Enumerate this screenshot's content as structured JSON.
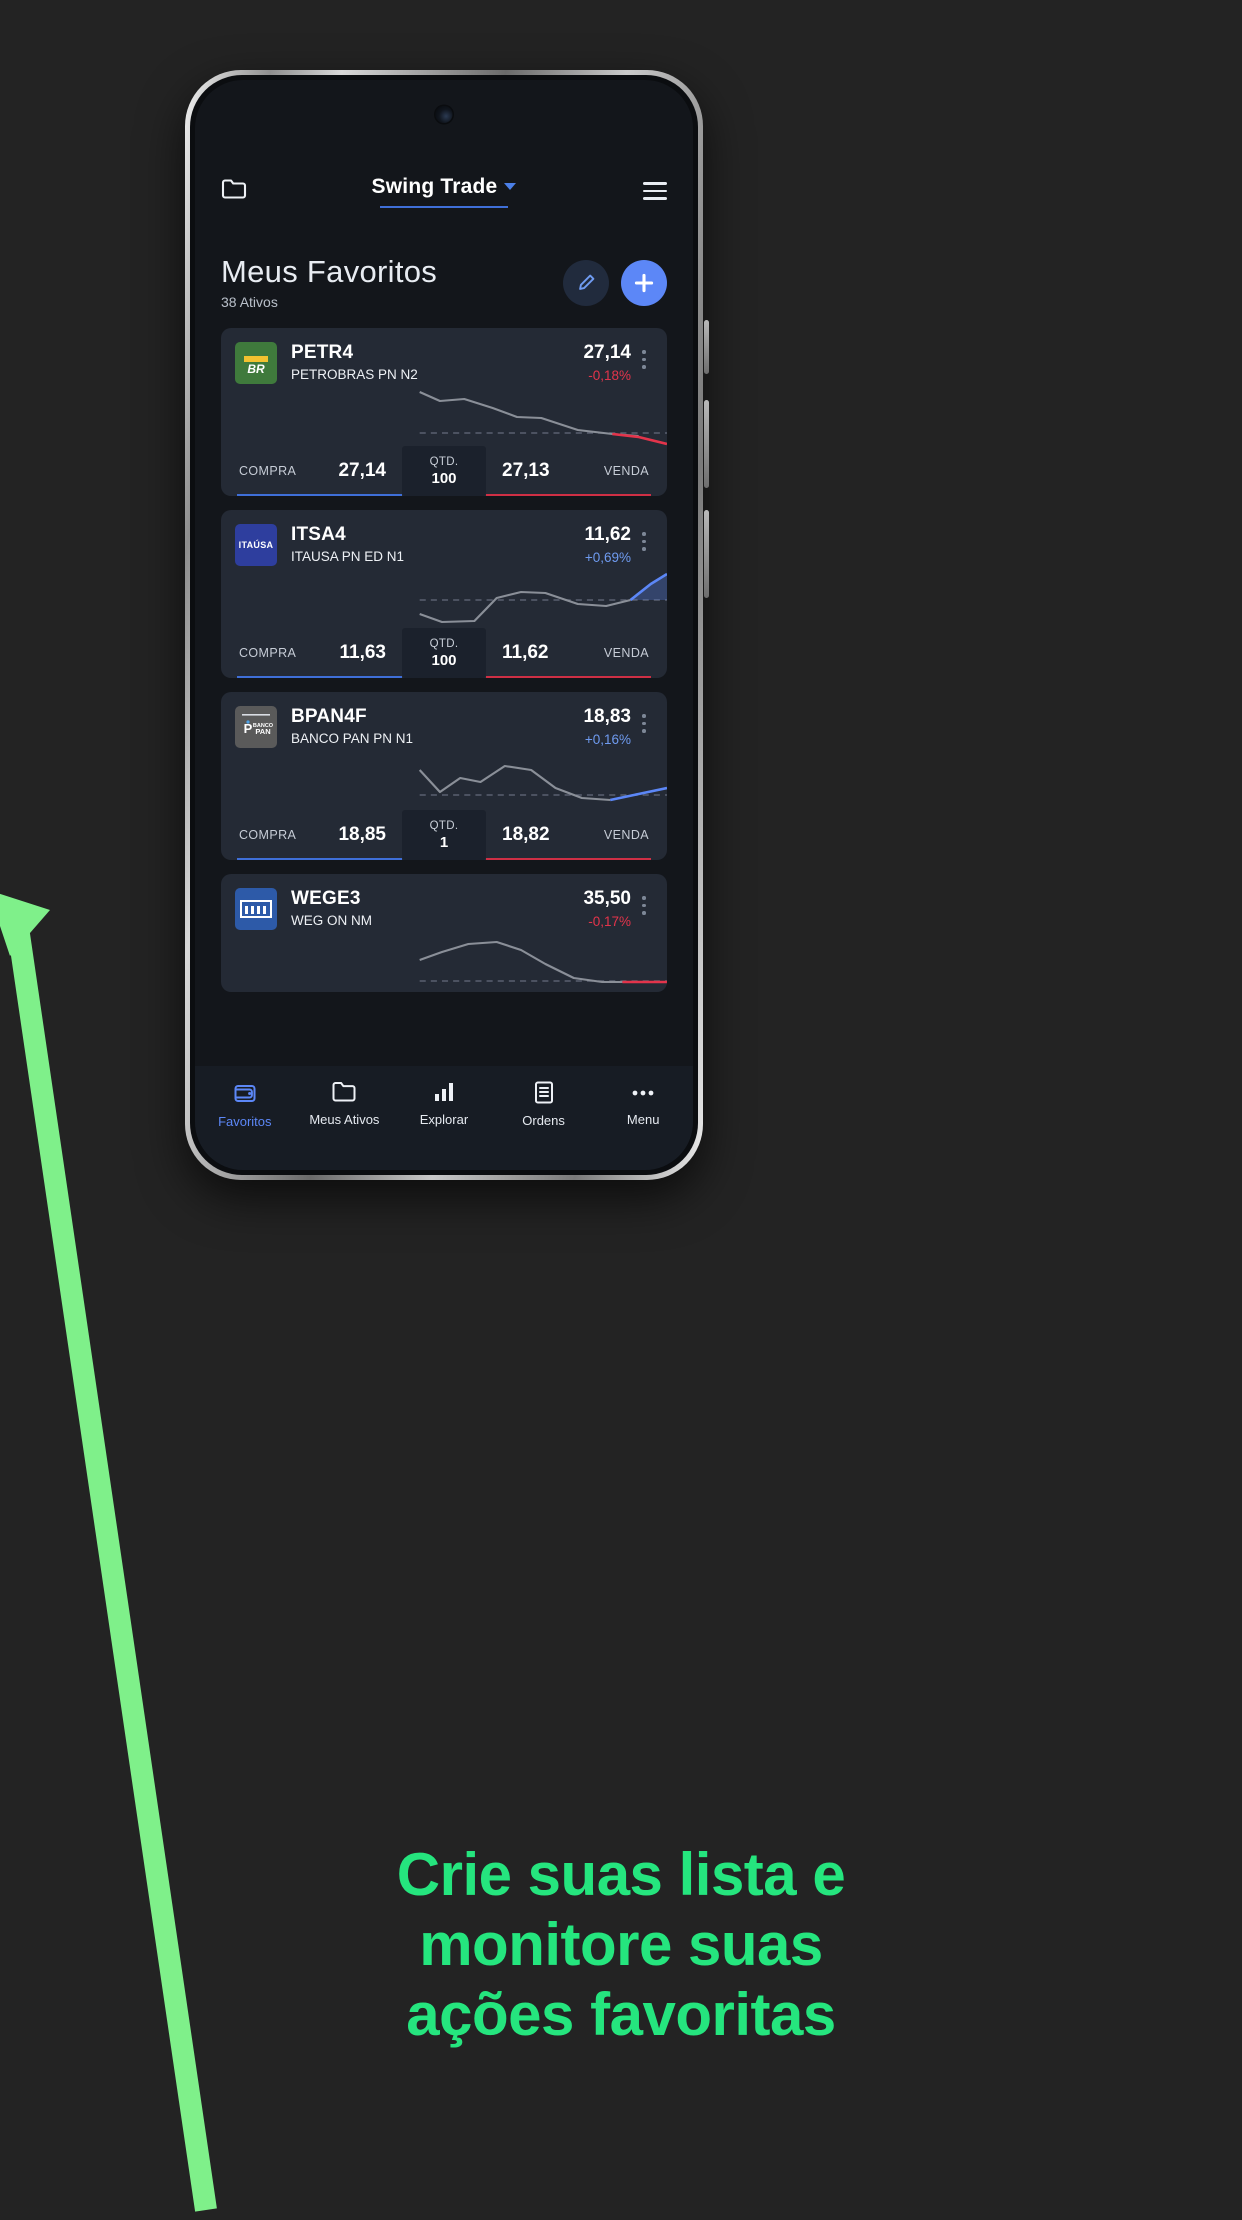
{
  "app": {
    "header": {
      "folder_icon": "folder-icon",
      "title": "Swing Trade",
      "dropdown_icon": "chevron-down-icon",
      "menu_icon": "hamburger-icon"
    },
    "favorites": {
      "title": "Meus Favoritos",
      "subtitle": "38 Ativos",
      "edit_icon": "pencil-icon",
      "add_icon": "plus-icon"
    },
    "labels": {
      "buy": "COMPRA",
      "sell": "VENDA",
      "qty": "QTD."
    },
    "stocks": [
      {
        "ticker": "PETR4",
        "company": "PETROBRAS PN N2",
        "price": "27,14",
        "change": "-0,18%",
        "direction": "down",
        "logo_text": "BR",
        "buy_price": "27,14",
        "sell_price": "27,13",
        "qty": "100"
      },
      {
        "ticker": "ITSA4",
        "company": "ITAUSA PN ED N1",
        "price": "11,62",
        "change": "+0,69%",
        "direction": "up",
        "logo_text": "ITAÚSA",
        "buy_price": "11,63",
        "sell_price": "11,62",
        "qty": "100"
      },
      {
        "ticker": "BPAN4F",
        "company": "BANCO PAN PN N1",
        "price": "18,83",
        "change": "+0,16%",
        "direction": "up",
        "logo_text": "BANCO PAN",
        "buy_price": "18,85",
        "sell_price": "18,82",
        "qty": "1"
      },
      {
        "ticker": "WEGE3",
        "company": "WEG ON NM",
        "price": "35,50",
        "change": "-0,17%",
        "direction": "down",
        "logo_text": "weg",
        "buy_price": "",
        "sell_price": "",
        "qty": ""
      }
    ],
    "bottom_nav": [
      {
        "label": "Favoritos",
        "icon": "wallet-icon",
        "active": true
      },
      {
        "label": "Meus Ativos",
        "icon": "folder-icon",
        "active": false
      },
      {
        "label": "Explorar",
        "icon": "bar-chart-icon",
        "active": false
      },
      {
        "label": "Ordens",
        "icon": "document-icon",
        "active": false
      },
      {
        "label": "Menu",
        "icon": "ellipsis-icon",
        "active": false
      }
    ]
  },
  "tagline": {
    "line1": "Crie suas lista e",
    "line2": "monitore suas",
    "line3": "ações favoritas"
  },
  "colors": {
    "background": "#232323",
    "accent_green": "#25e57e",
    "arrow_green": "#7ff08a",
    "brand_blue": "#5c87f7",
    "up_blue": "#6f9bf0",
    "down_red": "#e3344b",
    "card": "#242a35",
    "screen": "#13161b"
  },
  "chart_data": [
    {
      "type": "line",
      "ticker": "PETR4",
      "trend": "down",
      "values": [
        62,
        55,
        57,
        50,
        38,
        36,
        26,
        16,
        12,
        8,
        4
      ],
      "highlight_color": "#e3344b",
      "line_color": "#8a8f98",
      "reference_line": 10
    },
    {
      "type": "line",
      "ticker": "ITSA4",
      "trend": "up",
      "values": [
        20,
        10,
        12,
        14,
        38,
        45,
        44,
        36,
        28,
        30,
        62
      ],
      "highlight_color": "#5c87f7",
      "line_color": "#8a8f98",
      "reference_line": 32
    },
    {
      "type": "line",
      "ticker": "BPAN4F",
      "trend": "up",
      "values": [
        44,
        22,
        34,
        30,
        48,
        44,
        26,
        14,
        10,
        12,
        26
      ],
      "highlight_color": "#5c87f7",
      "line_color": "#8a8f98",
      "reference_line": 14
    },
    {
      "type": "line",
      "ticker": "WEGE3",
      "trend": "down",
      "values": [
        30,
        40,
        52,
        54,
        46,
        30,
        14,
        8,
        6,
        6,
        6
      ],
      "highlight_color": "#e3344b",
      "line_color": "#8a8f98",
      "reference_line": 8
    }
  ]
}
